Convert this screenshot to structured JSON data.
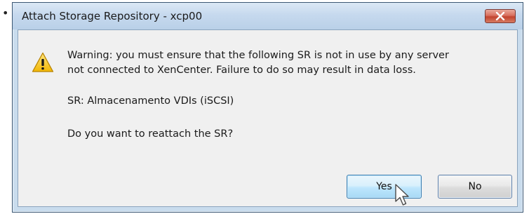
{
  "page": {
    "bullet": "•"
  },
  "dialog": {
    "title": "Attach Storage Repository - xcp00",
    "close_icon": "close-icon",
    "warning_icon": "warning-icon",
    "message_line_1": "Warning: you must ensure that the following SR is not in use by any server",
    "message_line_2": "not connected to XenCenter. Failure to do so may result in data loss.",
    "sr_line": "SR:  Almacenamento VDIs (iSCSI)",
    "question": "Do you want to reattach the SR?",
    "buttons": {
      "yes": "Yes",
      "no": "No"
    },
    "colors": {
      "titlebar": "#c6d9ee",
      "close_button": "#c2432e",
      "client_background": "#f0f0f0",
      "yes_button_focus": "#bee6fd"
    }
  }
}
